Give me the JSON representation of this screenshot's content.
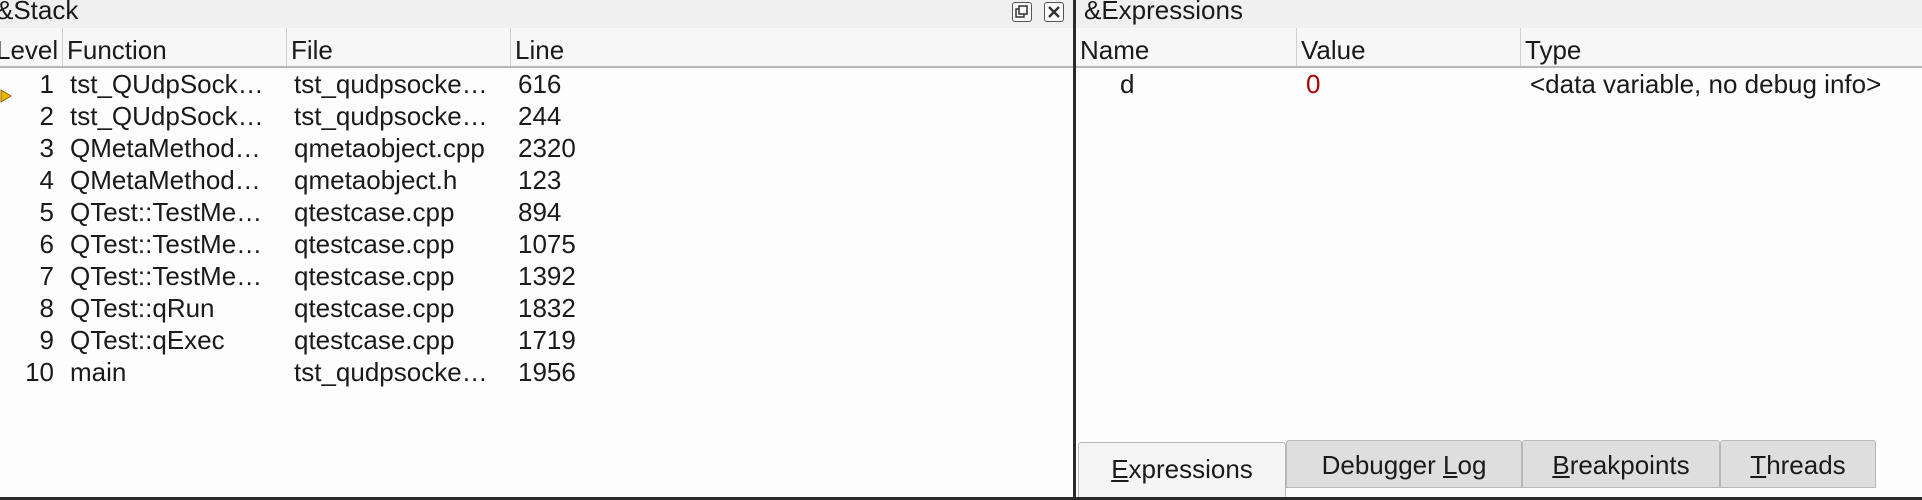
{
  "stack": {
    "title": "&Stack",
    "columns": [
      "Level",
      "Function",
      "File",
      "Line"
    ],
    "rows": [
      {
        "level": "1",
        "function": "tst_QUdpSock…",
        "file": "tst_qudpsocke…",
        "line": "616",
        "current": true
      },
      {
        "level": "2",
        "function": "tst_QUdpSock…",
        "file": "tst_qudpsocke…",
        "line": "244"
      },
      {
        "level": "3",
        "function": "QMetaMethod…",
        "file": "qmetaobject.cpp",
        "line": "2320"
      },
      {
        "level": "4",
        "function": "QMetaMethod…",
        "file": "qmetaobject.h",
        "line": "123"
      },
      {
        "level": "5",
        "function": "QTest::TestMe…",
        "file": "qtestcase.cpp",
        "line": "894"
      },
      {
        "level": "6",
        "function": "QTest::TestMe…",
        "file": "qtestcase.cpp",
        "line": "1075"
      },
      {
        "level": "7",
        "function": "QTest::TestMe…",
        "file": "qtestcase.cpp",
        "line": "1392"
      },
      {
        "level": "8",
        "function": "QTest::qRun",
        "file": "qtestcase.cpp",
        "line": "1832"
      },
      {
        "level": "9",
        "function": "QTest::qExec",
        "file": "qtestcase.cpp",
        "line": "1719"
      },
      {
        "level": "10",
        "function": "main",
        "file": "tst_qudpsocke…",
        "line": "1956"
      }
    ]
  },
  "expressions": {
    "title": "&Expressions",
    "columns": [
      "Name",
      "Value",
      "Type"
    ],
    "rows": [
      {
        "name": "d",
        "value": "0",
        "type": "<data variable, no debug info>"
      }
    ]
  },
  "tabs": [
    {
      "label": "Expressions",
      "mnemonic": "E",
      "rest": "xpressions",
      "active": true
    },
    {
      "label": "Debugger Log",
      "before": "Debugger ",
      "mnemonic": "L",
      "rest": "og",
      "active": false
    },
    {
      "label": "Breakpoints",
      "mnemonic": "B",
      "rest": "reakpoints",
      "active": false
    },
    {
      "label": "Threads",
      "mnemonic": "T",
      "rest": "hreads",
      "active": false
    }
  ],
  "icons": {
    "float": "float-window-icon",
    "close": "close-window-icon",
    "current_frame": "current-frame-arrow-icon"
  },
  "colors": {
    "value_changed": "#b00000",
    "frame_marker": "#e8b400"
  }
}
